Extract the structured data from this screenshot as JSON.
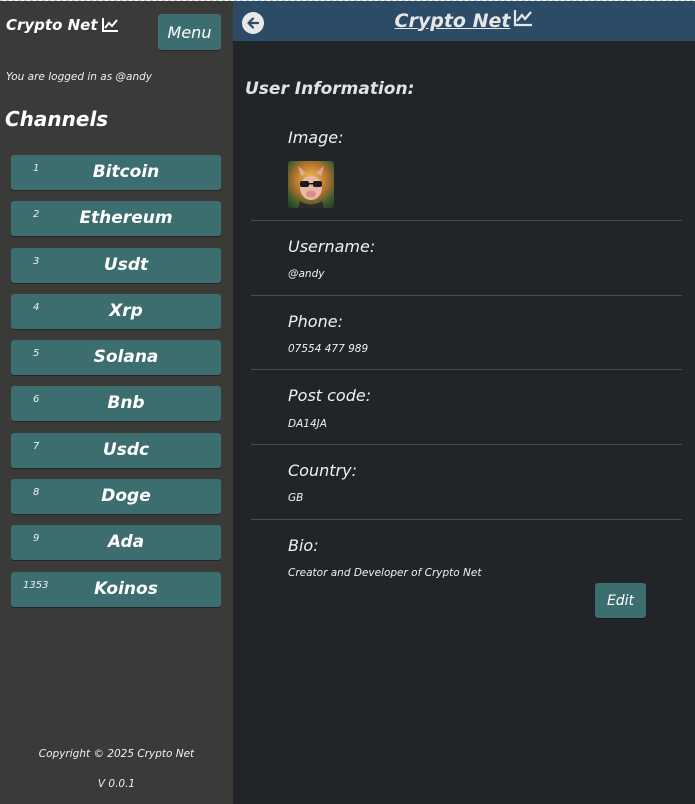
{
  "app": {
    "brand": "Crypto Net",
    "header_title": "Crypto Net"
  },
  "sidebar": {
    "menu_label": "Menu",
    "logged_in_text": "You are logged in as @andy",
    "channels_title": "Channels",
    "channels": [
      {
        "id": "1",
        "name": "Bitcoin"
      },
      {
        "id": "2",
        "name": "Ethereum"
      },
      {
        "id": "3",
        "name": "Usdt"
      },
      {
        "id": "4",
        "name": "Xrp"
      },
      {
        "id": "5",
        "name": "Solana"
      },
      {
        "id": "6",
        "name": "Bnb"
      },
      {
        "id": "7",
        "name": "Usdc"
      },
      {
        "id": "8",
        "name": "Doge"
      },
      {
        "id": "9",
        "name": "Ada"
      },
      {
        "id": "1353",
        "name": "Koinos"
      }
    ],
    "copyright": "Copyright © 2025 Crypto Net",
    "version": "V 0.0.1"
  },
  "profile": {
    "section_title": "User Information:",
    "image_label": "Image:",
    "username_label": "Username:",
    "username": "@andy",
    "phone_label": "Phone:",
    "phone": "07554 477 989",
    "postcode_label": "Post code:",
    "postcode": "DA14JA",
    "country_label": "Country:",
    "country": "GB",
    "bio_label": "Bio:",
    "bio": "Creator and Developer of Crypto Net",
    "edit_label": "Edit"
  },
  "colors": {
    "sidebar_bg": "#3a3a39",
    "main_bg": "#222528",
    "header_bg": "#2c4b66",
    "button_teal": "#3d6e6f"
  },
  "icons": {
    "brand": "chart-line-icon",
    "back": "arrow-left-circle-icon"
  }
}
